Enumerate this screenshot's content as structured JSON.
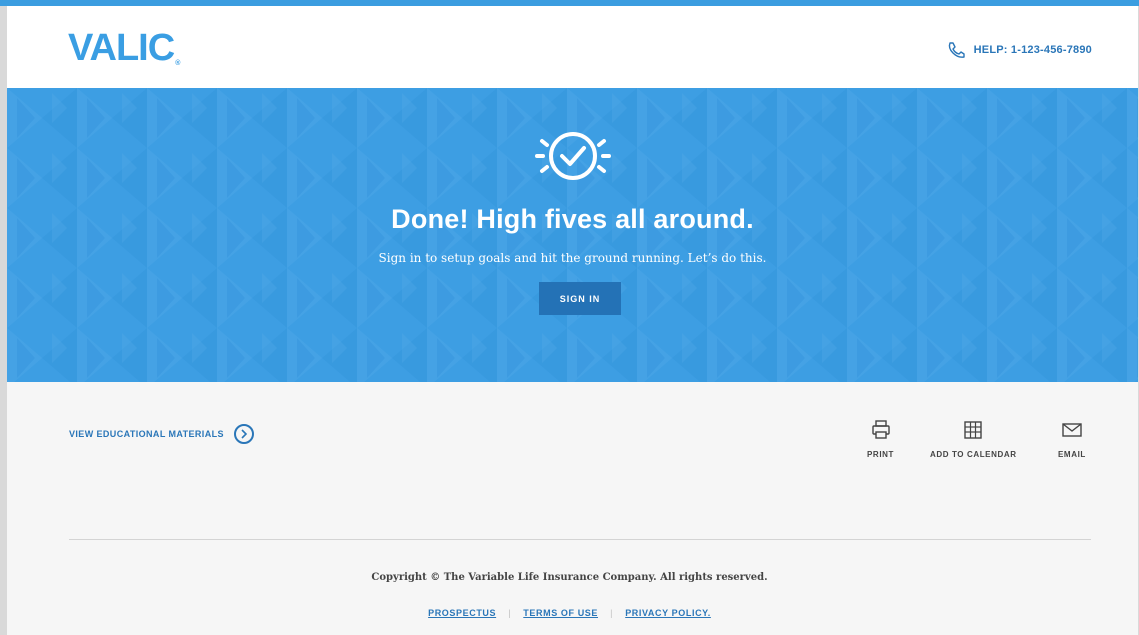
{
  "brand": {
    "logo_text": "VALIC",
    "logo_mark": "®",
    "accent_color": "#3d9ee3",
    "dark_blue": "#2472b6"
  },
  "header": {
    "help_text": "HELP: 1-123-456-7890",
    "help_icon": "phone-icon"
  },
  "hero": {
    "icon": "check-circle-icon",
    "title": "Done! High fives all around.",
    "subtitle": "Sign in to setup goals and hit the ground running. Let’s do this.",
    "signin_label": "SIGN IN"
  },
  "main": {
    "edu_label": "VIEW EDUCATIONAL MATERIALS",
    "edu_icon": "chevron-right-circle-icon",
    "actions": [
      {
        "label": "PRINT",
        "icon": "printer-icon"
      },
      {
        "label": "ADD TO CALENDAR",
        "icon": "calendar-icon"
      },
      {
        "label": "EMAIL",
        "icon": "envelope-icon"
      }
    ]
  },
  "footer": {
    "copyright": "Copyright © The Variable Life Insurance Company. All rights reserved.",
    "links": [
      "PROSPECTUS",
      "TERMS OF USE",
      "PRIVACY POLICY."
    ]
  }
}
